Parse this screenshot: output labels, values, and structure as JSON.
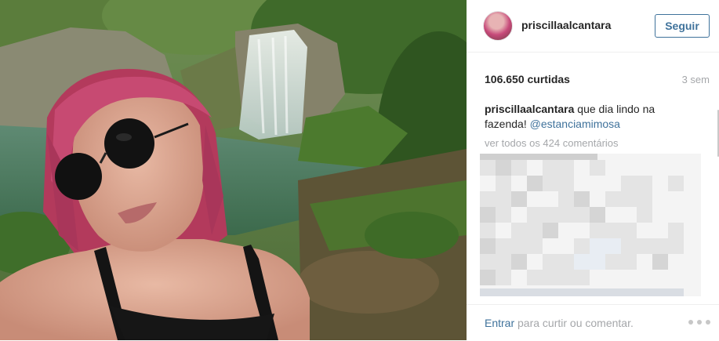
{
  "post": {
    "username": "priscillaalcantara",
    "follow_label": "Seguir",
    "likes": "106.650 curtidas",
    "time_ago": "3 sem",
    "caption": {
      "user": "priscillaalcantara",
      "text": " que dia lindo na fazenda! ",
      "mention": "@estanciamimosa"
    },
    "view_all_comments": "ver todos os 424 comentários",
    "footer": {
      "login_link": "Entrar",
      "login_text": " para curtir ou comentar."
    }
  },
  "icons": {
    "more": "more-options-icon"
  },
  "colors": {
    "link_blue": "#3f729b",
    "muted_gray": "#a5a7aa",
    "text_dark": "#262626"
  }
}
